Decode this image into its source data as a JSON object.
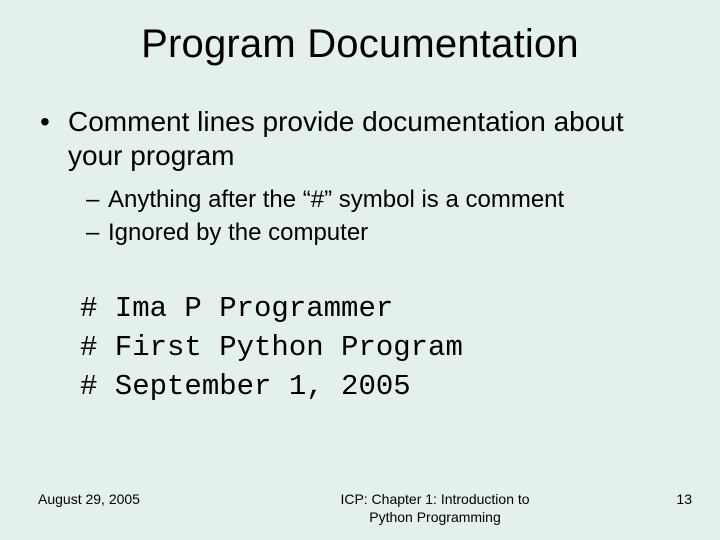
{
  "title": "Program Documentation",
  "bullets": {
    "main": "Comment lines provide documentation about your program",
    "sub1": "Anything after the “#” symbol is a comment",
    "sub2": "Ignored by the computer"
  },
  "code": {
    "line1": "# Ima P Programmer",
    "line2": "# First Python Program",
    "line3": "# September 1, 2005"
  },
  "footer": {
    "date": "August 29, 2005",
    "center_line1": "ICP: Chapter 1: Introduction to",
    "center_line2": "Python Programming",
    "page": "13"
  }
}
